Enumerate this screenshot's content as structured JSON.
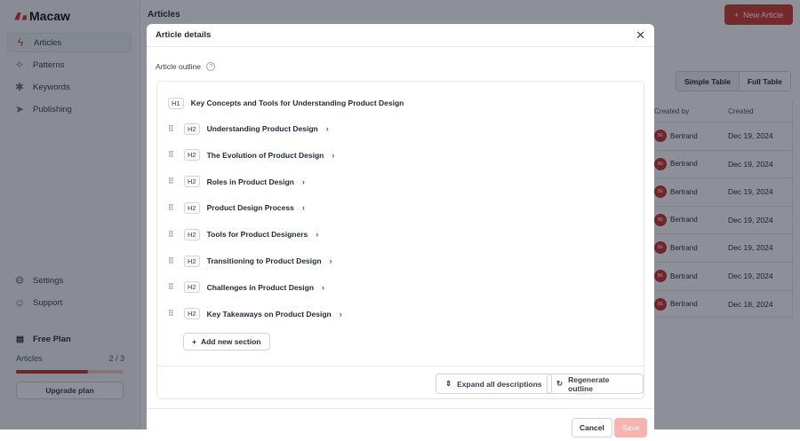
{
  "app": {
    "name": "Macaw"
  },
  "sidebar": {
    "items": [
      {
        "label": "Articles",
        "icon": "bolt-icon",
        "active": true
      },
      {
        "label": "Patterns",
        "icon": "sparkles-icon"
      },
      {
        "label": "Keywords",
        "icon": "asterisk-icon"
      },
      {
        "label": "Publishing",
        "icon": "send-icon"
      }
    ],
    "bottom": [
      {
        "label": "Settings",
        "icon": "gear-icon"
      },
      {
        "label": "Support",
        "icon": "support-icon"
      }
    ],
    "plan": {
      "title": "Free Plan",
      "label": "Articles",
      "count": "2 / 3",
      "progress": 0.667,
      "upgrade": "Upgrade plan"
    }
  },
  "header": {
    "title": "Articles",
    "new_button": "New Article"
  },
  "table": {
    "view_options": [
      "Simple Table",
      "Full Table"
    ],
    "columns": [
      "Created by",
      "Created"
    ],
    "rows": [
      {
        "initials": "BE",
        "by": "Bertrand",
        "date": "Dec 19, 2024"
      },
      {
        "initials": "BE",
        "by": "Bertrand",
        "date": "Dec 19, 2024"
      },
      {
        "initials": "BE",
        "by": "Bertrand",
        "date": "Dec 19, 2024"
      },
      {
        "initials": "BE",
        "by": "Bertrand",
        "date": "Dec 19, 2024"
      },
      {
        "initials": "BE",
        "by": "Bertrand",
        "date": "Dec 19, 2024"
      },
      {
        "initials": "BE",
        "by": "Bertrand",
        "date": "Dec 19, 2024"
      },
      {
        "initials": "BE",
        "by": "Bertrand",
        "date": "Dec 18, 2024"
      }
    ]
  },
  "modal": {
    "title": "Article details",
    "outline_label": "Article outline",
    "h1": {
      "tag": "H1",
      "text": "Key Concepts and Tools for Understanding Product Design"
    },
    "sections": [
      {
        "tag": "H2",
        "text": "Understanding Product Design"
      },
      {
        "tag": "H2",
        "text": "The Evolution of Product Design"
      },
      {
        "tag": "H2",
        "text": "Roles in Product Design"
      },
      {
        "tag": "H2",
        "text": "Product Design Process"
      },
      {
        "tag": "H2",
        "text": "Tools for Product Designers"
      },
      {
        "tag": "H2",
        "text": "Transitioning to Product Design"
      },
      {
        "tag": "H2",
        "text": "Challenges in Product Design"
      },
      {
        "tag": "H2",
        "text": "Key Takeaways on Product Design"
      }
    ],
    "add_section": "Add new section",
    "expand": "Expand all descriptions",
    "regenerate": "Regenerate outline",
    "cancel": "Cancel",
    "save": "Save"
  }
}
